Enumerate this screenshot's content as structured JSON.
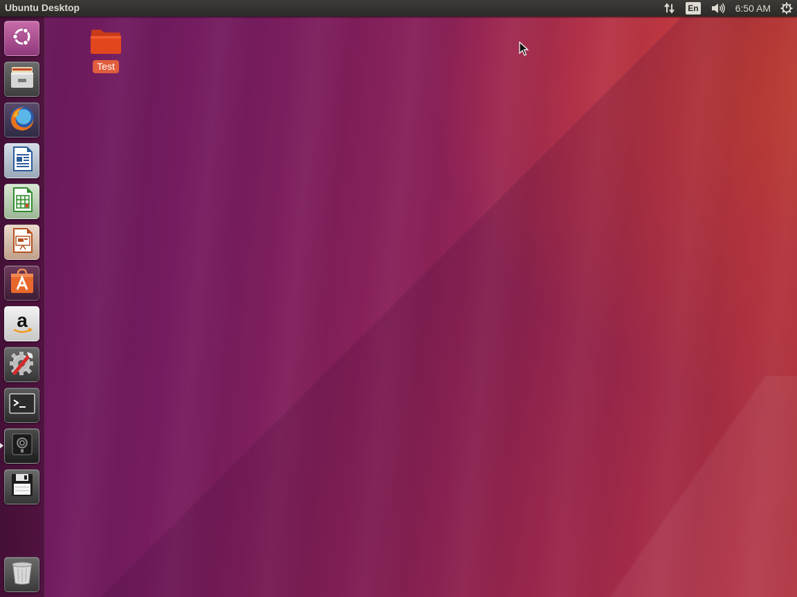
{
  "top_panel": {
    "title": "Ubuntu Desktop",
    "indicators": {
      "network_icon": "network-updown-icon",
      "keyboard_layout": "En",
      "sound_icon": "volume-icon",
      "clock": "6:50 AM",
      "session_icon": "power-gear-icon"
    }
  },
  "launcher": {
    "items": [
      {
        "name": "dash-home",
        "icon": "ubuntu-logo-icon"
      },
      {
        "name": "files",
        "icon": "file-cabinet-icon"
      },
      {
        "name": "firefox",
        "icon": "firefox-icon"
      },
      {
        "name": "libreoffice-writer",
        "icon": "writer-document-icon"
      },
      {
        "name": "libreoffice-calc",
        "icon": "calc-spreadsheet-icon"
      },
      {
        "name": "libreoffice-impress",
        "icon": "impress-presentation-icon"
      },
      {
        "name": "ubuntu-software",
        "icon": "software-bag-icon"
      },
      {
        "name": "amazon",
        "icon": "amazon-icon"
      },
      {
        "name": "system-settings",
        "icon": "settings-gear-wrench-icon"
      },
      {
        "name": "terminal",
        "icon": "terminal-icon"
      },
      {
        "name": "screenshot-camera",
        "icon": "camera-icon"
      },
      {
        "name": "save-floppy",
        "icon": "floppy-disk-icon"
      },
      {
        "name": "trash",
        "icon": "trash-icon"
      }
    ]
  },
  "desktop": {
    "icons": [
      {
        "label": "Test",
        "icon": "folder-icon",
        "selected": true
      }
    ]
  },
  "colors": {
    "panel": "#3c3b37",
    "selection": "#e25d3d",
    "folder": "#e2461d"
  }
}
